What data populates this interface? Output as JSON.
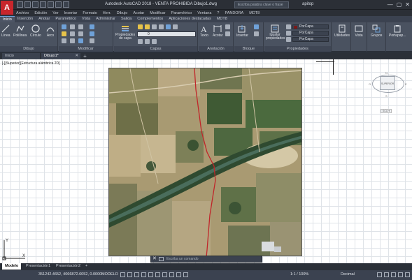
{
  "title_bar": {
    "app_logo": "A",
    "title": "Autodesk AutoCAD 2018 - VENTA PROHIBIDA    Dibujo1.dwg",
    "search_placeholder": "Escriba palabra clave o frase",
    "user": "apitop",
    "win_min": "—",
    "win_max": "▢",
    "win_close": "✕"
  },
  "menu": [
    "Archivo",
    "Edición",
    "Ver",
    "Insertar",
    "Formato",
    "Herr.",
    "Dibujo",
    "Acotar",
    "Modificar",
    "Paramétrico",
    "Ventana",
    "?",
    "PANDORA",
    "MDT8"
  ],
  "ribbon_tabs": [
    "Inicio",
    "Inserción",
    "Anotar",
    "Paramétrico",
    "Vista",
    "Administrar",
    "Salida",
    "Complementos",
    "Aplicaciones destacadas",
    "MDT8"
  ],
  "ribbon": {
    "dibujo": {
      "label": "Dibujo",
      "tools": [
        "Línea",
        "Polilínea",
        "Círculo",
        "Arco"
      ]
    },
    "modificar": {
      "label": "Modificar"
    },
    "capas": {
      "label": "Capas",
      "props_button": "Propiedades de capa",
      "current_layer": "0"
    },
    "anotacion": {
      "label": "Anotación",
      "tools": [
        "Texto",
        "Acotar"
      ]
    },
    "bloque": {
      "label": "Bloque",
      "tools": [
        "Insertar"
      ]
    },
    "propiedades": {
      "label": "Propiedades",
      "match": "Igualar propiedades",
      "color": "PorCapa",
      "linetype": "PorCapa",
      "lineweight": "PorCapa",
      "color_swatch": "#7a1a1a"
    },
    "utilidades": "Utilidades",
    "vista": "Vista",
    "grupos": "Grupos",
    "portapapeles": "Portapap..."
  },
  "doc_tabs": {
    "start": "Inicio",
    "active": "Dibujo1*",
    "close": "✕",
    "plus": "+"
  },
  "viewport_label": "[-][Superior][Estructura alámbrica 2D]",
  "viewcube": {
    "face": "SUPERIOR",
    "n": "N",
    "o": "O",
    "e": "E",
    "s": "S",
    "scu": "SCU ▾"
  },
  "ucs": {
    "y": "Y",
    "x": "X"
  },
  "command_line": {
    "placeholder": "Escriba un comando",
    "close": "✕"
  },
  "layout_tabs": [
    "Modelo",
    "Presentación1",
    "Presentación2",
    "+"
  ],
  "status": {
    "coords": "351242.4652, 4066872.6052, 0.0000",
    "model": "MODELO",
    "scale": "1:1 / 100%",
    "units": "Decimal"
  },
  "colors": {
    "accent": "#6fa1d8",
    "logo": "#c8262c",
    "boundary": "#c0262a",
    "ribbon_bg": "#4a5260"
  }
}
